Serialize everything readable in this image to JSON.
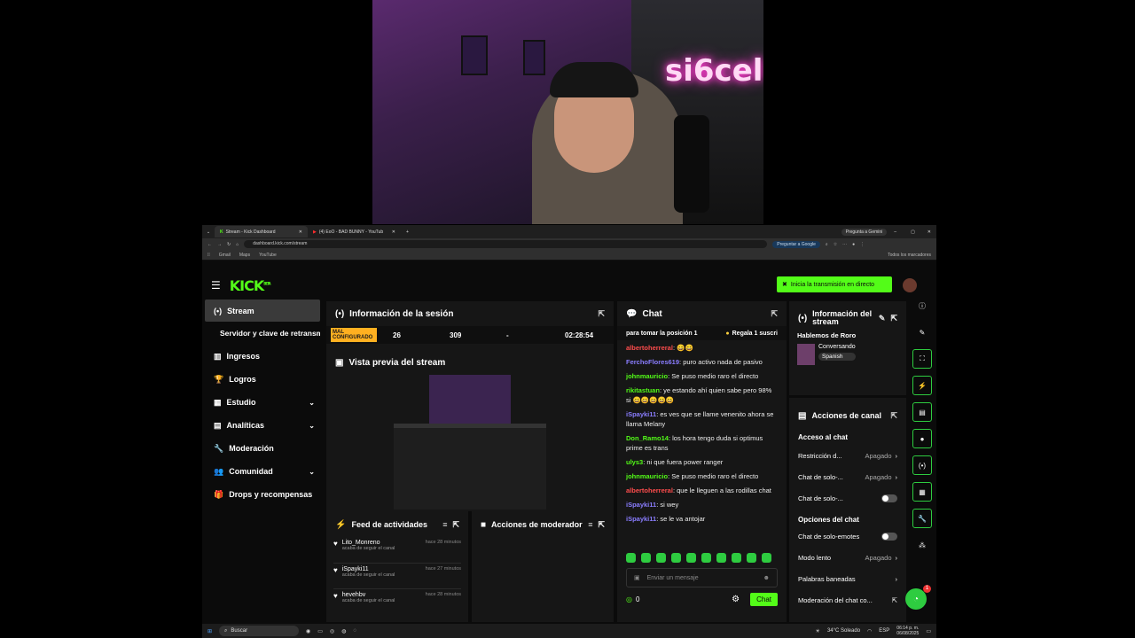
{
  "browser": {
    "tabs": [
      {
        "label": "Stream - Kick Dashboard"
      },
      {
        "label": "(4) EoO - BAD BUNNY - YouTub"
      }
    ],
    "url": "dashboard.kick.com/stream",
    "ask_google": "Preguntar a Google",
    "ask_gemini": "Pregunta a Gemini",
    "bookmarks": [
      "Gmail",
      "Maps",
      "YouTube"
    ],
    "all_bookmarks": "Todos los marcadores"
  },
  "kick": {
    "logo": "KICK",
    "logo_sup": "BETA",
    "go_live": "Inicia la transmisión en directo",
    "sidebar": [
      {
        "label": "Stream",
        "active": true,
        "icon": "stream-icon"
      },
      {
        "label": "Servidor y clave de retransmisión",
        "icon": ""
      },
      {
        "label": "Ingresos",
        "icon": "chart-icon"
      },
      {
        "label": "Logros",
        "icon": "trophy-icon"
      },
      {
        "label": "Estudio",
        "icon": "studio-icon",
        "chevron": true
      },
      {
        "label": "Analíticas",
        "icon": "analytics-icon",
        "chevron": true
      },
      {
        "label": "Moderación",
        "icon": "wrench-icon"
      },
      {
        "label": "Comunidad",
        "icon": "community-icon",
        "chevron": true
      },
      {
        "label": "Drops y recompensas",
        "icon": "drops-icon"
      }
    ],
    "session": {
      "title": "Información de la sesión",
      "status": "MAL CONFIGURADO",
      "viewers": "26",
      "followers": "309",
      "dash": "-",
      "uptime": "02:28:54"
    },
    "preview": {
      "title": "Vista previa del stream"
    },
    "feed": {
      "title": "Feed de actividades",
      "items": [
        {
          "user": "Lito_Monreno",
          "time": "hace 28 minutos",
          "action": "acaba de seguir el canal"
        },
        {
          "user": "iSpayki11",
          "time": "hace 27 minutos",
          "action": "acaba de seguir el canal"
        },
        {
          "user": "hevehbv",
          "time": "hace 28 minutos",
          "action": "acaba de seguir el canal"
        }
      ]
    },
    "mod_actions": {
      "title": "Acciones de moderador"
    },
    "chat": {
      "title": "Chat",
      "pinned_left": "para tomar la posición 1",
      "pinned_right": "Regala 1 suscri",
      "messages": [
        {
          "user": "albertoherreral",
          "color": "#ff4d4d",
          "text": " 😄😄"
        },
        {
          "user": "FerchoFlores619",
          "color": "#8a7dff",
          "text": " puro activo nada de pasivo"
        },
        {
          "user": "johnmauricio",
          "color": "#53fc18",
          "text": " Se puso medio raro el directo"
        },
        {
          "user": "rikitastuan",
          "color": "#53fc18",
          "text": " ye estando ahí quien sabe pero 98% si 😄😄😄😄😄"
        },
        {
          "user": "iSpayki11",
          "color": "#8a7dff",
          "text": " es ves que se llame venenito ahora se llama Melany"
        },
        {
          "user": "Don_Ramo14",
          "color": "#53fc18",
          "text": " los hora tengo duda si optimus prime es trans"
        },
        {
          "user": "ulys3",
          "color": "#53fc18",
          "text": " ni que fuera power ranger"
        },
        {
          "user": "johnmauricio",
          "color": "#53fc18",
          "text": " Se puso medio raro el directo"
        },
        {
          "user": "albertoherreral",
          "color": "#ff4d4d",
          "text": " que le lleguen a las rodillas chat"
        },
        {
          "user": "iSpayki11",
          "color": "#8a7dff",
          "text": " si wey"
        },
        {
          "user": "iSpayki11",
          "color": "#8a7dff",
          "text": " se le va antojar"
        }
      ],
      "placeholder": "Enviar un mensaje",
      "points": "0",
      "send": "Chat"
    },
    "stream_info": {
      "title": "Información del stream",
      "stream_title": "Hablemos de Roro",
      "category": "Conversando",
      "language": "Spanish"
    },
    "channel_actions": {
      "title": "Acciones de canal",
      "access_heading": "Acceso al chat",
      "rows1": [
        {
          "label": "Restricción d...",
          "value": "Apagado"
        },
        {
          "label": "Chat de solo-...",
          "value": "Apagado"
        },
        {
          "label": "Chat de solo-...",
          "value": ""
        }
      ],
      "options_heading": "Opciones del chat",
      "rows2": [
        {
          "label": "Chat de solo-emotes",
          "value": ""
        },
        {
          "label": "Modo lento",
          "value": "Apagado"
        },
        {
          "label": "Palabras baneadas",
          "value": ""
        },
        {
          "label": "Moderación del chat co...",
          "value": ""
        }
      ]
    },
    "notif_count": "1"
  },
  "webcam": {
    "neon": "si6cel"
  },
  "taskbar": {
    "search": "Buscar",
    "weather": "34°C Soleado",
    "lang": "ESP",
    "time": "06:14 p. m.",
    "date": "06/08/2025"
  }
}
